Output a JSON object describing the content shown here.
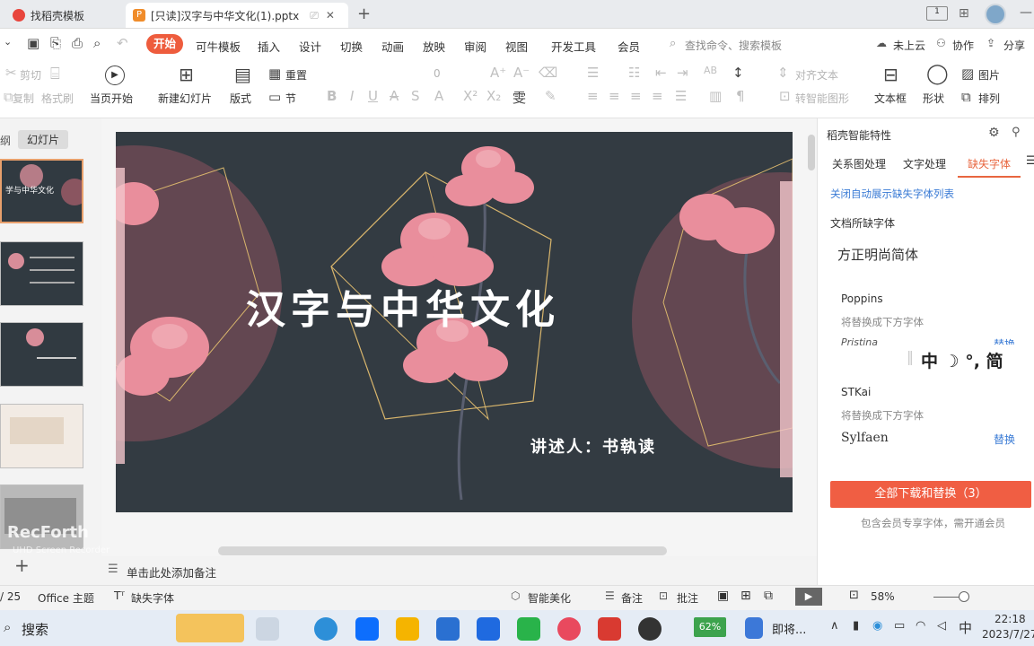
{
  "tabs": [
    {
      "label": "找稻壳模板"
    },
    {
      "label": "[只读]汉字与中华文化(1).pptx"
    }
  ],
  "menu": {
    "start": "开始",
    "items": [
      "可牛模板",
      "插入",
      "设计",
      "切换",
      "动画",
      "放映",
      "审阅",
      "视图",
      "开发工具",
      "会员"
    ],
    "search_placeholder": "查找命令、搜索模板",
    "cloud": "未上云",
    "collab": "协作",
    "share": "分享"
  },
  "toolbar": {
    "cut": "剪切",
    "copy": "复制",
    "format_painter": "格式刷",
    "from_current": "当页开始",
    "new_slide": "新建幻灯片",
    "layout": "版式",
    "reset": "重置",
    "section": "节",
    "font_size": "0",
    "align_text": "对齐文本",
    "smart_graphic": "转智能图形",
    "text_box": "文本框",
    "shape": "形状",
    "picture": "图片",
    "arrange": "排列"
  },
  "left_panel": {
    "outline_tab": "纲",
    "slides_tab": "幻灯片"
  },
  "slide": {
    "title": "汉字与中华文化",
    "presenter": "讲述人：书執读"
  },
  "right_panel": {
    "header": "稻壳智能特性",
    "tabs": [
      "关系图处理",
      "文字处理",
      "缺失字体"
    ],
    "close_link": "关闭自动展示缺失字体列表",
    "section_title": "文档所缺字体",
    "font1_preview": "方正明尚简体",
    "font2_name": "Poppins",
    "font2_replace": "将替换成下方字体",
    "font2_sub": "Pristina",
    "font2_action": "替换",
    "font3_name": "STKai",
    "font3_replace": "将替换成下方字体",
    "font3_sub": "Sylfaen",
    "font3_action": "替换",
    "download_btn": "全部下载和替换（3）",
    "member_note": "包含会员专享字体，需开通会员",
    "ime_chars": "中 ☽ °, 简"
  },
  "notes_placeholder": "单击此处添加备注",
  "watermark": {
    "line1": "RecForth",
    "line2": "UHD Screen Recorder"
  },
  "status": {
    "page": "/ 25",
    "theme": "Office 主题",
    "missing_font": "缺失字体",
    "beautify": "智能美化",
    "notes": "备注",
    "comments": "批注",
    "zoom": "58%"
  },
  "taskbar": {
    "search": "搜索",
    "battery": "62%",
    "running_app": "即将...",
    "ime": "中",
    "time": "22:18",
    "date": "2023/7/27"
  },
  "colors": {
    "accent": "#ee5c3d",
    "slide_bg": "#333b42",
    "flower": "#e98e9c",
    "link": "#3a7bd5"
  }
}
